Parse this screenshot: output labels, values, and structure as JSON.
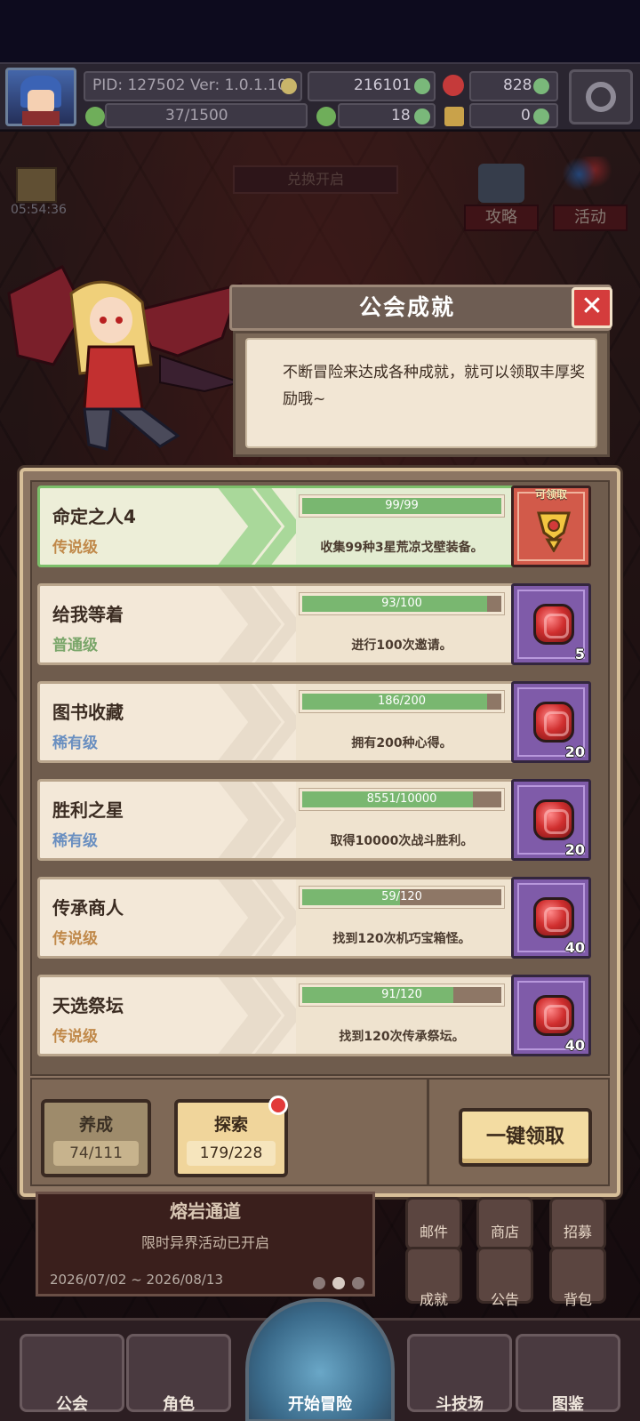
{
  "hud": {
    "pid": "PID: 127502",
    "version": "Ver: 1.0.1.10",
    "gold": "216101",
    "gems": "828",
    "stamina": "37/1500",
    "clover": "18",
    "key": "0"
  },
  "background": {
    "timer": "05:54:36",
    "exchange": "兑换开启",
    "btn_guide": "攻略",
    "btn_activity": "活动"
  },
  "dialog": {
    "title": "公会成就",
    "close_icon": "close-icon",
    "text": "不断冒险来达成各种成就，就可以领取丰厚奖励哦~"
  },
  "achievements": [
    {
      "name": "命定之人4",
      "tier": "传说级",
      "tier_color": "#c0894a",
      "progress": "99/99",
      "fraction": 1.0,
      "desc": "收集99种3星荒凉戈壁装备。",
      "reward_label": "可领取",
      "reward_icon": "trophy-icon",
      "done": true
    },
    {
      "name": "给我等着",
      "tier": "普通级",
      "tier_color": "#7aa66a",
      "progress": "93/100",
      "fraction": 0.93,
      "desc": "进行100次邀请。",
      "reward_count": "5",
      "reward_icon": "gem-icon"
    },
    {
      "name": "图书收藏",
      "tier": "稀有级",
      "tier_color": "#6a8fc0",
      "progress": "186/200",
      "fraction": 0.93,
      "desc": "拥有200种心得。",
      "reward_count": "20",
      "reward_icon": "gem-icon"
    },
    {
      "name": "胜利之星",
      "tier": "稀有级",
      "tier_color": "#6a8fc0",
      "progress": "8551/10000",
      "fraction": 0.8551,
      "desc": "取得10000次战斗胜利。",
      "reward_count": "20",
      "reward_icon": "gem-icon"
    },
    {
      "name": "传承商人",
      "tier": "传说级",
      "tier_color": "#c0894a",
      "progress": "59/120",
      "fraction": 0.4917,
      "desc": "找到120次机巧宝箱怪。",
      "reward_count": "40",
      "reward_icon": "gem-icon"
    },
    {
      "name": "天选祭坛",
      "tier": "传说级",
      "tier_color": "#c0894a",
      "progress": "91/120",
      "fraction": 0.7583,
      "desc": "找到120次传承祭坛。",
      "reward_count": "40",
      "reward_icon": "gem-icon"
    }
  ],
  "tabs": {
    "grow_label": "养成",
    "grow_count": "74/111",
    "explore_label": "探索",
    "explore_count": "179/228",
    "claim_all": "一键领取"
  },
  "event": {
    "title": "熔岩通道",
    "subtitle": "限时异界活动已开启",
    "dates": "2026/07/02 ~ 2026/08/13"
  },
  "side_buttons": [
    "邮件",
    "商店",
    "招募",
    "成就",
    "公告",
    "背包"
  ],
  "nav": {
    "guild": "公会",
    "character": "角色",
    "start": "开始冒险",
    "arena": "斗技场",
    "codex": "图鉴"
  }
}
